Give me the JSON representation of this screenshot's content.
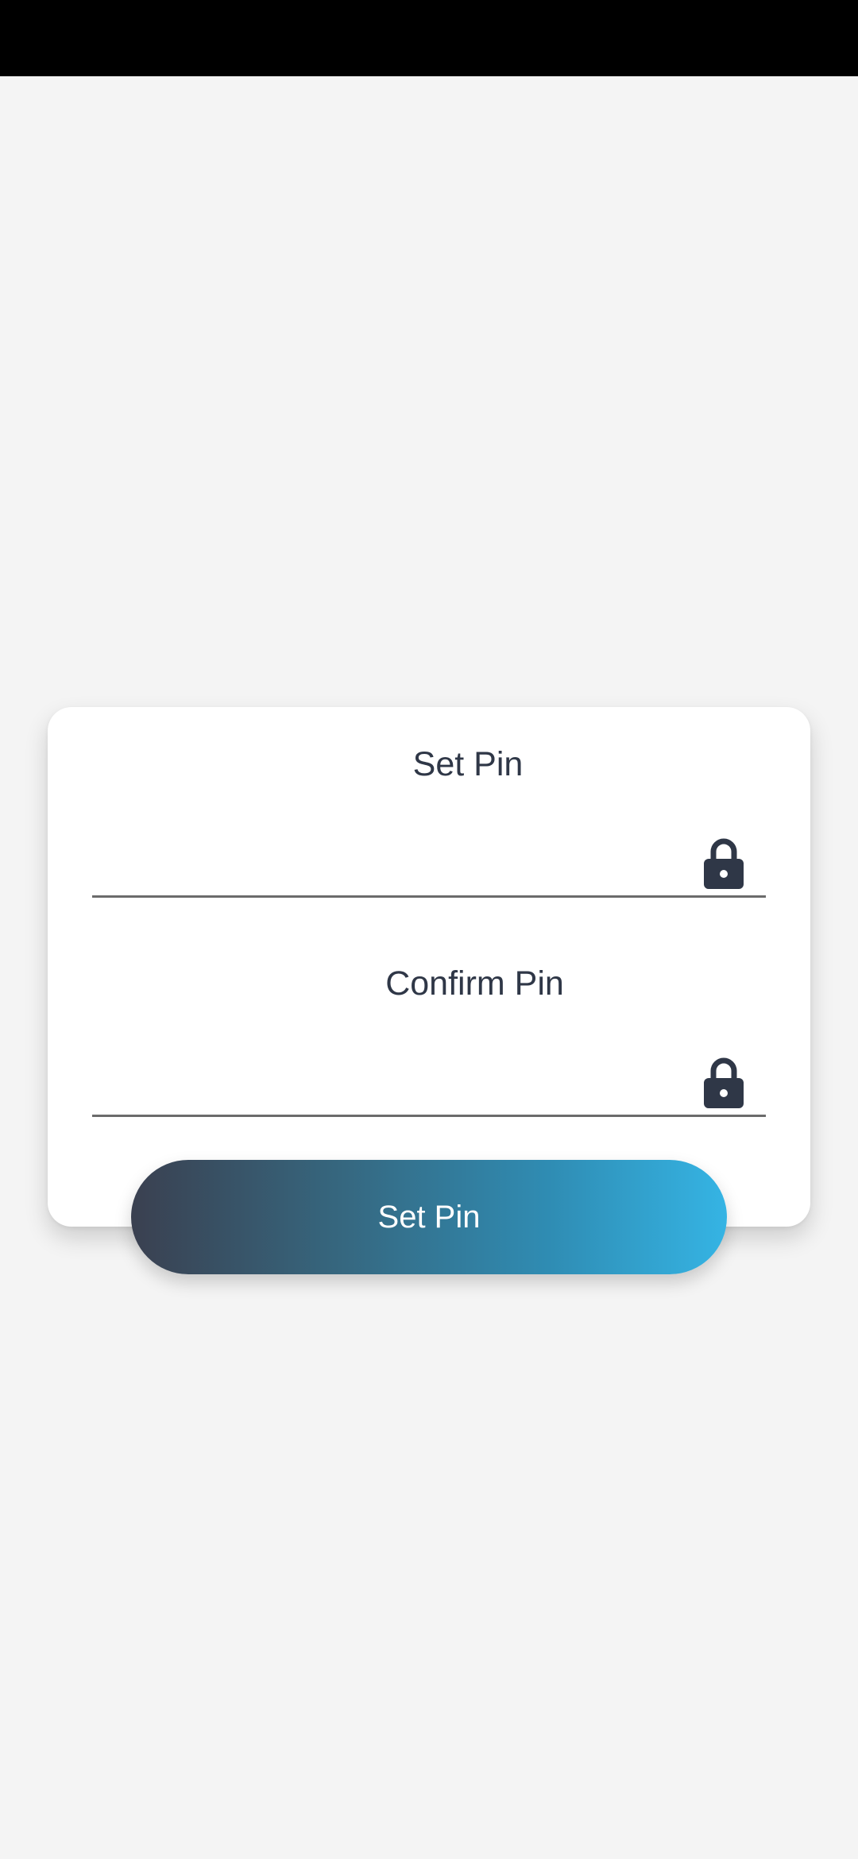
{
  "form": {
    "set_pin_label": "Set Pin",
    "set_pin_value": "",
    "confirm_pin_label": "Confirm Pin",
    "confirm_pin_value": ""
  },
  "icons": {
    "field_icon": "lock-icon"
  },
  "submit": {
    "label": "Set Pin"
  },
  "colors": {
    "text": "#2f3747",
    "gradient_start": "#3a4050",
    "gradient_end": "#35b4e4",
    "background": "#f4f4f4"
  }
}
